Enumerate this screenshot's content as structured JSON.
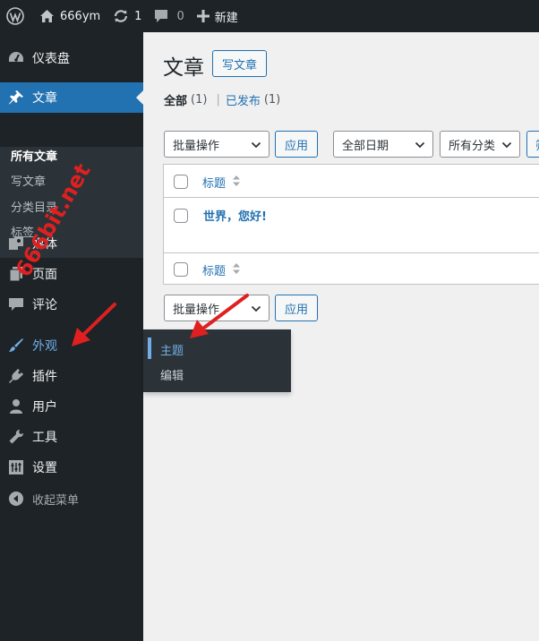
{
  "adminbar": {
    "site_name": "666ym",
    "updates_count": "1",
    "comments_count": "0",
    "new_label": "新建"
  },
  "sidebar": {
    "items": [
      {
        "label": "仪表盘",
        "icon": "dashboard-icon"
      },
      {
        "label": "文章",
        "icon": "pin-icon"
      },
      {
        "label": "媒体",
        "icon": "media-icon"
      },
      {
        "label": "页面",
        "icon": "page-icon"
      },
      {
        "label": "评论",
        "icon": "comment-icon"
      },
      {
        "label": "外观",
        "icon": "brush-icon"
      },
      {
        "label": "插件",
        "icon": "plugin-icon"
      },
      {
        "label": "用户",
        "icon": "user-icon"
      },
      {
        "label": "工具",
        "icon": "wrench-icon"
      },
      {
        "label": "设置",
        "icon": "settings-icon"
      }
    ],
    "submenu": [
      "所有文章",
      "写文章",
      "分类目录",
      "标签"
    ],
    "collapse_label": "收起菜单"
  },
  "flyout": {
    "items": [
      "主题",
      "编辑"
    ]
  },
  "page": {
    "title": "文章",
    "add_new": "写文章",
    "filter_all": "全部",
    "filter_all_count": "(1)",
    "filter_sep": "|",
    "filter_published": "已发布",
    "filter_published_count": "(1)"
  },
  "toolbar": {
    "bulk_actions": "批量操作",
    "apply": "应用",
    "all_dates": "全部日期",
    "all_categories": "所有分类",
    "filter_partial": "筛"
  },
  "table": {
    "column_title": "标题",
    "rows": [
      {
        "title": "世界，您好!"
      }
    ]
  },
  "watermark": "666bit.net",
  "colors": {
    "adminbar_bg": "#1d2327",
    "accent": "#2271b1",
    "current_highlight": "#72aee6",
    "annotation": "#e02020"
  }
}
